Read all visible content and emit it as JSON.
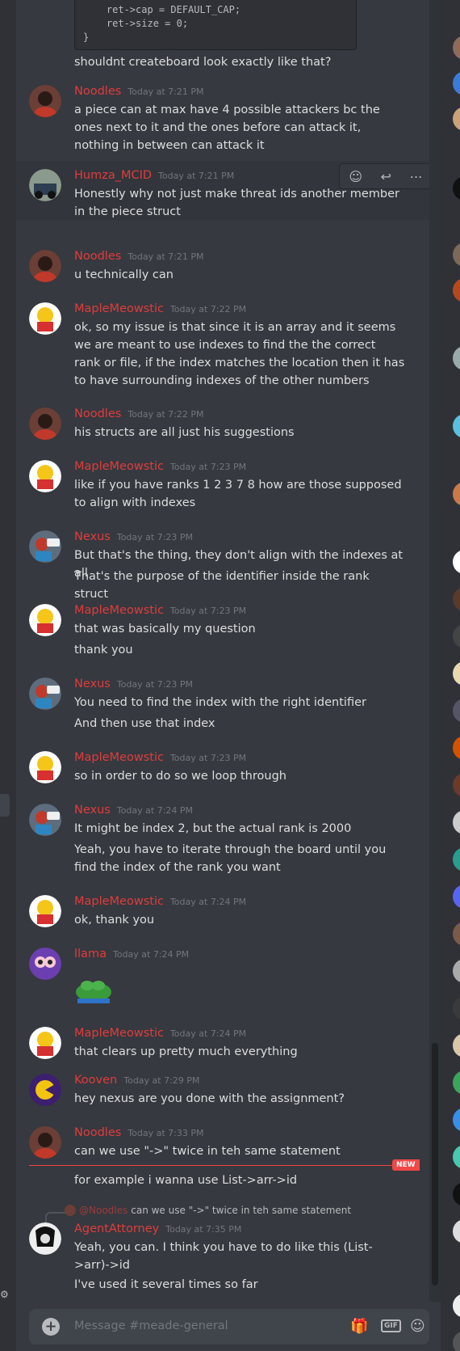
{
  "channel": {
    "code_lines": [
      "    ret->cap = DEFAULT_CAP;",
      "    ret->size = 0;",
      "}"
    ],
    "composer_placeholder": "Message #meade-general",
    "new_badge": "NEW",
    "reply_preview": {
      "author": "@Noodles",
      "text": "can we use \"->\" twice in teh same statement"
    }
  },
  "colors": {
    "username": "#e03c3c",
    "background": "#36393f",
    "new_divider": "#f04747"
  },
  "messages": [
    {
      "name": "",
      "time": "",
      "lines": [
        "shouldnt createboard look exactly like that?"
      ]
    },
    {
      "name": "Noodles",
      "time": "Today at 7:21 PM",
      "lines": [
        "a piece can at max have 4 possible attackers bc the ones next to it and the ones before can attack it, nothing in between can attack it"
      ]
    },
    {
      "name": "Humza_MCID",
      "time": "Today at 7:21 PM",
      "lines": [
        "Honestly why not just make threat ids another member in the piece struct"
      ]
    },
    {
      "name": "Noodles",
      "time": "Today at 7:21 PM",
      "lines": [
        "u technically can"
      ]
    },
    {
      "name": "MapleMeowstic",
      "time": "Today at 7:22 PM",
      "lines": [
        "ok, so my issue is that since it is an array and it seems we are meant to use indexes to find the the correct rank or file, if the index matches the location then it has to have surrounding indexes of the other numbers"
      ]
    },
    {
      "name": "Noodles",
      "time": "Today at 7:22 PM",
      "lines": [
        "his structs are all just his suggestions"
      ]
    },
    {
      "name": "MapleMeowstic",
      "time": "Today at 7:23 PM",
      "lines": [
        "like if you have ranks 1 2 3 7 8 how are those supposed to align with indexes"
      ]
    },
    {
      "name": "Nexus",
      "time": "Today at 7:23 PM",
      "lines": [
        "But that's the thing, they don't align with the indexes at all",
        "That's the purpose of the identifier inside the rank struct"
      ]
    },
    {
      "name": "MapleMeowstic",
      "time": "Today at 7:23 PM",
      "lines": [
        "that was basically my question",
        "thank you"
      ]
    },
    {
      "name": "Nexus",
      "time": "Today at 7:23 PM",
      "lines": [
        "You need to find the index with the right identifier",
        "And then use that index"
      ]
    },
    {
      "name": "MapleMeowstic",
      "time": "Today at 7:23 PM",
      "lines": [
        "so in order to do so we loop through"
      ]
    },
    {
      "name": "Nexus",
      "time": "Today at 7:24 PM",
      "lines": [
        "It might be index 2, but the actual rank is 2000",
        "Yeah, you have to iterate through the board until you find the index of the rank you want"
      ]
    },
    {
      "name": "MapleMeowstic",
      "time": "Today at 7:24 PM",
      "lines": [
        "ok, thank you"
      ]
    },
    {
      "name": "llama",
      "time": "Today at 7:24 PM",
      "lines": []
    },
    {
      "name": "MapleMeowstic",
      "time": "Today at 7:24 PM",
      "lines": [
        "that clears up pretty much everything"
      ]
    },
    {
      "name": "Kooven",
      "time": "Today at 7:29 PM",
      "lines": [
        "hey nexus are you done with the assignment?"
      ]
    },
    {
      "name": "Noodles",
      "time": "Today at 7:33 PM",
      "lines": [
        "can we use \"->\" twice in teh same statement",
        "for example i wanna use List->arr->id"
      ]
    },
    {
      "name": "AgentAttorney",
      "time": "Today at 7:35 PM",
      "lines": [
        "Yeah, you can. I think you have to do like this (List->arr)->id",
        "I've used it several times so far"
      ]
    }
  ]
}
